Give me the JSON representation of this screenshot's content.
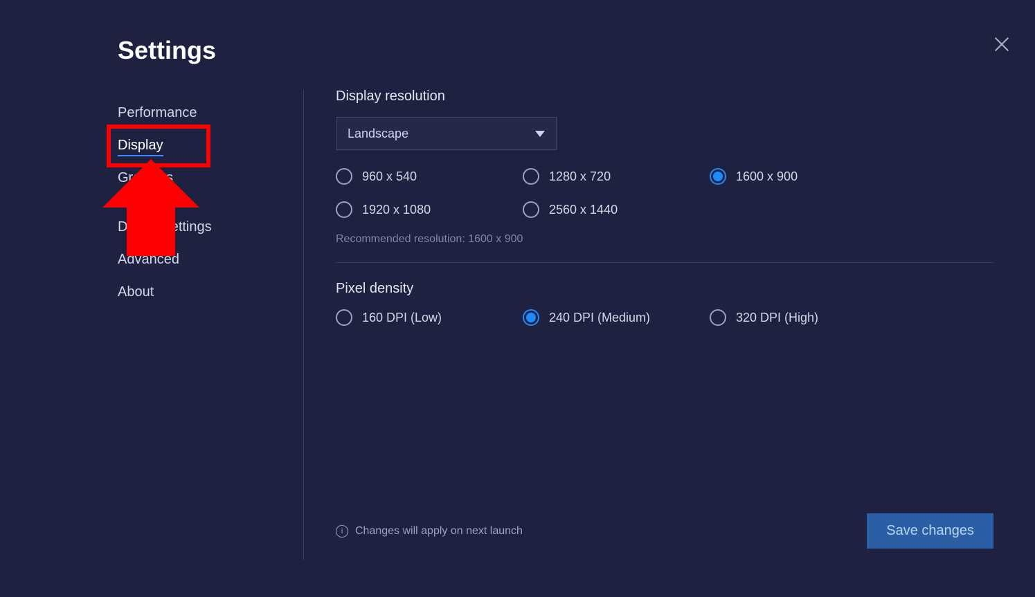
{
  "title": "Settings",
  "sidebar": {
    "items": [
      {
        "label": "Performance",
        "active": false
      },
      {
        "label": "Display",
        "active": true
      },
      {
        "label": "Graphics",
        "active": false
      },
      {
        "label": "",
        "active": false
      },
      {
        "label": "Device settings",
        "active": false
      },
      {
        "label": "Advanced",
        "active": false
      },
      {
        "label": "About",
        "active": false
      }
    ]
  },
  "display": {
    "resolution_title": "Display resolution",
    "orientation_selected": "Landscape",
    "resolutions": [
      {
        "label": "960 x 540",
        "selected": false
      },
      {
        "label": "1280 x 720",
        "selected": false
      },
      {
        "label": "1600 x 900",
        "selected": true
      },
      {
        "label": "1920 x 1080",
        "selected": false
      },
      {
        "label": "2560 x 1440",
        "selected": false
      }
    ],
    "recommended": "Recommended resolution: 1600 x 900",
    "density_title": "Pixel density",
    "densities": [
      {
        "label": "160 DPI (Low)",
        "selected": false
      },
      {
        "label": "240 DPI (Medium)",
        "selected": true
      },
      {
        "label": "320 DPI (High)",
        "selected": false
      }
    ]
  },
  "footer": {
    "note": "Changes will apply on next launch",
    "save": "Save changes"
  },
  "annotation": {
    "highlight_target": "Display sidebar item",
    "arrow_direction": "up"
  }
}
